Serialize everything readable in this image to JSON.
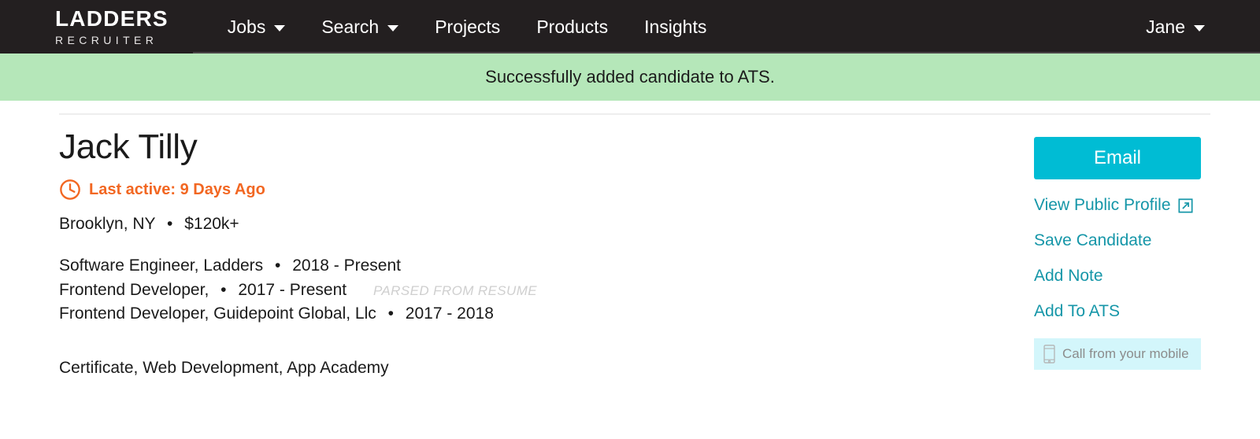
{
  "header": {
    "logo": {
      "primary": "LADDERS",
      "secondary": "RECRUITER"
    },
    "nav_items": [
      {
        "label": "Jobs",
        "has_caret": true
      },
      {
        "label": "Search",
        "has_caret": true
      },
      {
        "label": "Projects",
        "has_caret": false
      },
      {
        "label": "Products",
        "has_caret": false
      },
      {
        "label": "Insights",
        "has_caret": false
      }
    ],
    "account": {
      "label": "Jane",
      "has_caret": true
    },
    "background_color": "#231f20"
  },
  "banner": {
    "message": "Successfully added candidate to ATS.",
    "background_color": "#b5e7b9",
    "text_color": "#1b1b1b"
  },
  "candidate": {
    "name": "Jack Tilly",
    "last_active_icon": "clock-icon",
    "last_active": "Last active: 9 Days Ago",
    "last_active_color": "#f26722",
    "location": "Brooklyn, NY",
    "separator": "•",
    "salary": "$120k+",
    "experience": [
      {
        "title_company": "Software Engineer, Ladders",
        "separator": "•",
        "dates": "2018 - Present",
        "tag": ""
      },
      {
        "title_company": "Frontend Developer,",
        "separator": "•",
        "dates": "2017 - Present",
        "tag": "PARSED FROM RESUME"
      },
      {
        "title_company": "Frontend Developer, Guidepoint Global, Llc",
        "separator": "•",
        "dates": "2017 - 2018",
        "tag": ""
      }
    ],
    "education": [
      "Certificate, Web Development, App Academy"
    ]
  },
  "actions": {
    "email_button": "Email",
    "email_button_color": "#00bcd4",
    "link_color": "#1596a8",
    "links": [
      {
        "label": "View Public Profile",
        "icon": "external-link-icon"
      },
      {
        "label": "Save Candidate",
        "icon": ""
      },
      {
        "label": "Add Note",
        "icon": ""
      },
      {
        "label": "Add To ATS",
        "icon": ""
      }
    ],
    "mobile_box": {
      "icon": "mobile-phone-icon",
      "label": "Call from your mobile",
      "background_color": "#d3f6fb",
      "text_color": "#8c8c8c"
    }
  }
}
